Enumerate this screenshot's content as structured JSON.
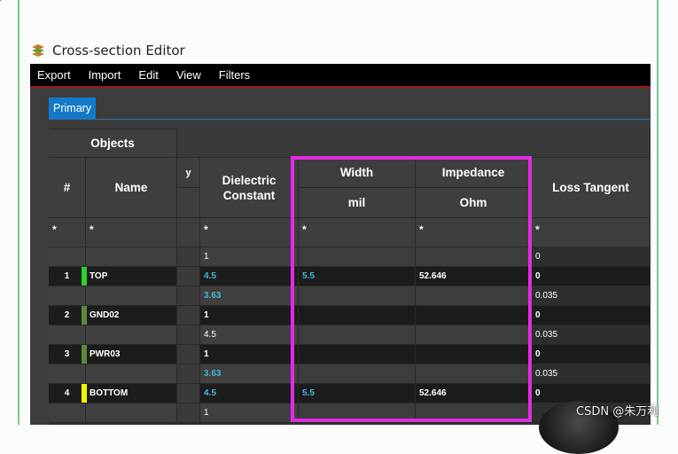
{
  "window": {
    "title": "Cross-section Editor",
    "icon": "layers-stack-icon"
  },
  "menu": [
    "Export",
    "Import",
    "Edit",
    "View",
    "Filters"
  ],
  "tabs": [
    {
      "label": "Primary",
      "active": true
    }
  ],
  "table": {
    "group_header": "Objects",
    "headers": {
      "num": "#",
      "name": "Name",
      "partial": "y",
      "dielectric": "Dielectric Constant",
      "width": "Width",
      "width_unit": "mil",
      "impedance": "Impedance",
      "impedance_unit": "Ohm",
      "loss": "Loss Tangent"
    },
    "filters": {
      "num": "*",
      "name": "*",
      "dielectric": "*",
      "width": "*",
      "impedance": "*",
      "loss": "*"
    },
    "rows": [
      {
        "type": "dielectric",
        "num": "",
        "name": "",
        "color": "",
        "dk": "1",
        "dk_cyan": false,
        "width": "",
        "impedance": "",
        "loss": "0"
      },
      {
        "type": "conductor",
        "num": "1",
        "name": "TOP",
        "color": "#2cd12c",
        "dk": "4.5",
        "dk_cyan": true,
        "width": "5.5",
        "impedance": "52.646",
        "loss": "0"
      },
      {
        "type": "dielectric",
        "num": "",
        "name": "",
        "color": "",
        "dk": "3.63",
        "dk_cyan": true,
        "width": "",
        "impedance": "",
        "loss": "0.035"
      },
      {
        "type": "conductor",
        "num": "2",
        "name": "GND02",
        "color": "#5c8a3a",
        "dk": "1",
        "dk_cyan": false,
        "width": "",
        "impedance": "",
        "loss": "0"
      },
      {
        "type": "dielectric",
        "num": "",
        "name": "",
        "color": "",
        "dk": "4.5",
        "dk_cyan": false,
        "width": "",
        "impedance": "",
        "loss": "0.035"
      },
      {
        "type": "conductor",
        "num": "3",
        "name": "PWR03",
        "color": "#5c8a3a",
        "dk": "1",
        "dk_cyan": false,
        "width": "",
        "impedance": "",
        "loss": "0"
      },
      {
        "type": "dielectric",
        "num": "",
        "name": "",
        "color": "",
        "dk": "3.63",
        "dk_cyan": true,
        "width": "",
        "impedance": "",
        "loss": "0.035"
      },
      {
        "type": "conductor",
        "num": "4",
        "name": "BOTTOM",
        "color": "#f4f400",
        "dk": "4.5",
        "dk_cyan": true,
        "width": "5.5",
        "impedance": "52.646",
        "loss": "0"
      },
      {
        "type": "dielectric",
        "num": "",
        "name": "",
        "color": "",
        "dk": "1",
        "dk_cyan": false,
        "width": "",
        "impedance": "",
        "loss": ""
      }
    ]
  },
  "highlight_color": "#e12ce1",
  "watermark": "CSDN @朱万利"
}
